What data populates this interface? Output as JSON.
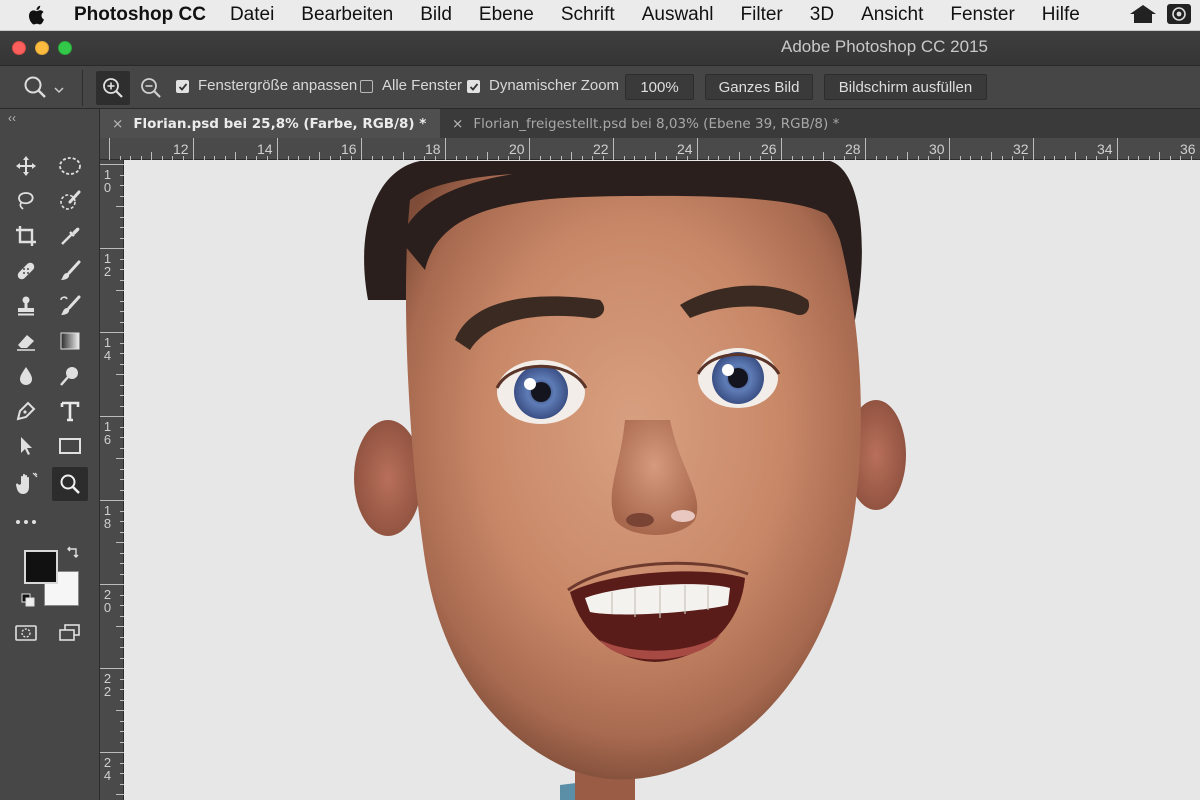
{
  "menubar": {
    "app_name": "Photoshop CC",
    "items": [
      "Datei",
      "Bearbeiten",
      "Bild",
      "Ebene",
      "Schrift",
      "Auswahl",
      "Filter",
      "3D",
      "Ansicht",
      "Fenster",
      "Hilfe"
    ]
  },
  "window": {
    "title": "Adobe Photoshop CC 2015"
  },
  "options": {
    "fit_window_label": "Fenstergröße anpassen",
    "all_windows_label": "Alle Fenster",
    "dynamic_zoom_label": "Dynamischer Zoom",
    "zoom_value_button": "100%",
    "fit_screen_button": "Ganzes Bild",
    "fill_screen_button": "Bildschirm ausfüllen",
    "fit_window_checked": true,
    "all_windows_checked": false,
    "dynamic_zoom_checked": true
  },
  "tabs": [
    {
      "label": "Florian.psd bei 25,8% (Farbe, RGB/8) *",
      "active": true
    },
    {
      "label": "Florian_freigestellt.psd bei 8,03% (Ebene 39, RGB/8) *",
      "active": false
    }
  ],
  "rulers": {
    "horizontal": [
      "12",
      "14",
      "16",
      "18",
      "20",
      "22",
      "24",
      "26",
      "28",
      "30",
      "32",
      "34",
      "36"
    ],
    "vertical": [
      "10",
      "12",
      "14",
      "16",
      "18",
      "20",
      "22",
      "24"
    ]
  },
  "tools": [
    "move-tool-icon",
    "marquee-tool-icon",
    "lasso-tool-icon",
    "quick-selection-tool-icon",
    "crop-tool-icon",
    "eyedropper-tool-icon",
    "healing-brush-tool-icon",
    "brush-tool-icon",
    "clone-stamp-tool-icon",
    "history-brush-tool-icon",
    "eraser-tool-icon",
    "gradient-tool-icon",
    "blur-tool-icon",
    "dodge-tool-icon",
    "pen-tool-icon",
    "type-tool-icon",
    "path-selection-tool-icon",
    "rectangle-tool-icon",
    "hand-tool-icon",
    "zoom-tool-icon",
    "more-tools-icon"
  ],
  "active_tool": "zoom-tool-icon",
  "colors": {
    "foreground": "#111111",
    "background": "#f6f6f6",
    "ui_dark": "#474747",
    "canvas_bg": "#e7e7e7"
  }
}
